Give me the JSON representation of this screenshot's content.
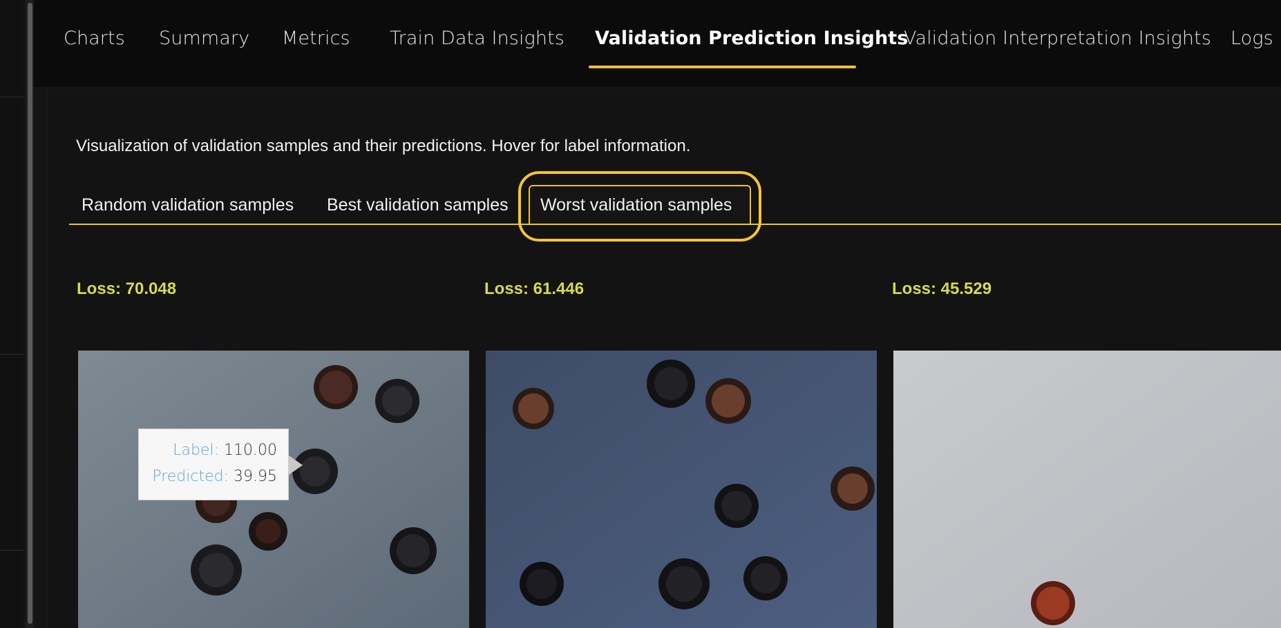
{
  "nav": {
    "tabs": [
      {
        "label": "Charts"
      },
      {
        "label": "Summary"
      },
      {
        "label": "Metrics"
      },
      {
        "label": "Train Data Insights"
      },
      {
        "label": "Validation Prediction Insights"
      },
      {
        "label": "Validation Interpretation Insights"
      },
      {
        "label": "Logs"
      }
    ],
    "active": "Validation Prediction Insights"
  },
  "description": "Visualization of validation samples and their predictions. Hover for label information.",
  "subtabs": [
    {
      "label": "Random validation samples"
    },
    {
      "label": "Best validation samples"
    },
    {
      "label": "Worst validation samples"
    }
  ],
  "active_subtab": "Worst validation samples",
  "samples": [
    {
      "loss": "Loss: 70.048"
    },
    {
      "loss": "Loss: 61.446"
    },
    {
      "loss": "Loss: 45.529"
    }
  ],
  "tooltip": {
    "label_key": "Label:",
    "label_value": "110.00",
    "predicted_key": "Predicted:",
    "predicted_value": "39.95"
  },
  "colors": {
    "accent": "#f1c12e",
    "loss_text": "#d5dc4e",
    "tooltip_key": "#5aa5d6"
  }
}
